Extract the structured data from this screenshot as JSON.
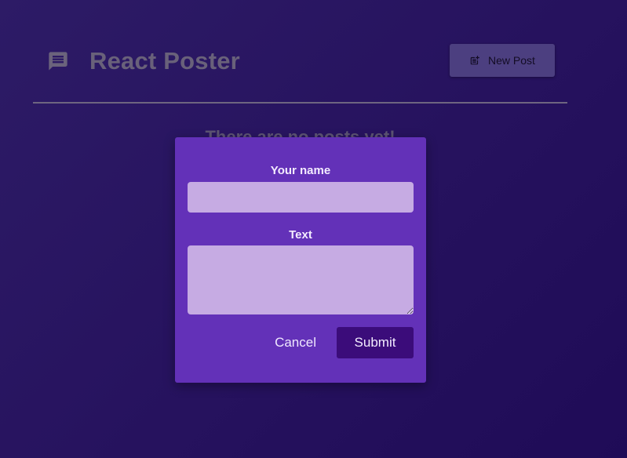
{
  "header": {
    "title": "React Poster",
    "logo_icon": "message-icon",
    "new_post_label": "New Post",
    "new_post_icon": "post-add-icon"
  },
  "main": {
    "empty_message": "There are no posts yet!"
  },
  "modal": {
    "name_label": "Your name",
    "name_value": "",
    "text_label": "Text",
    "text_value": "",
    "cancel_label": "Cancel",
    "submit_label": "Submit"
  },
  "colors": {
    "background": "#26125e",
    "modal": "#6331b8",
    "input": "#c6abe3",
    "submit": "#3b0c7a",
    "header_button": "#4c3f80"
  }
}
